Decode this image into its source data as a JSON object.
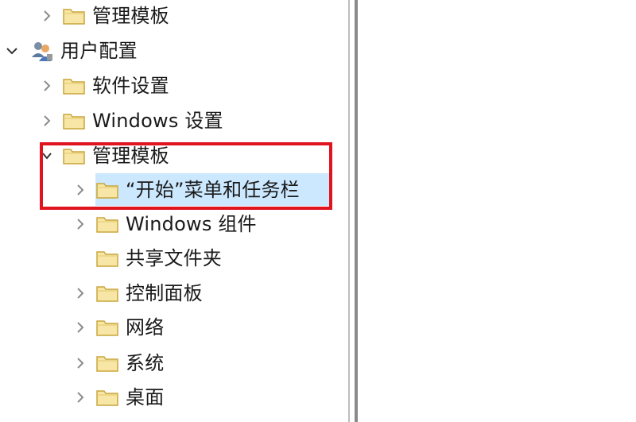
{
  "tree": {
    "items": [
      {
        "label": "管理模板",
        "expander": "collapsed"
      },
      {
        "label": "用户配置",
        "expander": "expanded"
      },
      {
        "label": "软件设置",
        "expander": "collapsed"
      },
      {
        "label": "Windows 设置",
        "expander": "collapsed"
      },
      {
        "label": "管理模板",
        "expander": "expanded"
      },
      {
        "label": "“开始”菜单和任务栏",
        "expander": "collapsed",
        "selected": true
      },
      {
        "label": "Windows 组件",
        "expander": "collapsed"
      },
      {
        "label": "共享文件夹",
        "expander": "none"
      },
      {
        "label": "控制面板",
        "expander": "collapsed"
      },
      {
        "label": "网络",
        "expander": "collapsed"
      },
      {
        "label": "系统",
        "expander": "collapsed"
      },
      {
        "label": "桌面",
        "expander": "collapsed"
      }
    ]
  },
  "colors": {
    "selection": "#cce8ff",
    "annotation_border": "#e0141f",
    "folder_fill": "#f7e6a6",
    "folder_stroke": "#c9a63c"
  },
  "icons": {
    "collapsed": "chevron-right-icon",
    "expanded": "chevron-down-icon",
    "folder": "folder-icon",
    "user_config": "users-icon"
  }
}
